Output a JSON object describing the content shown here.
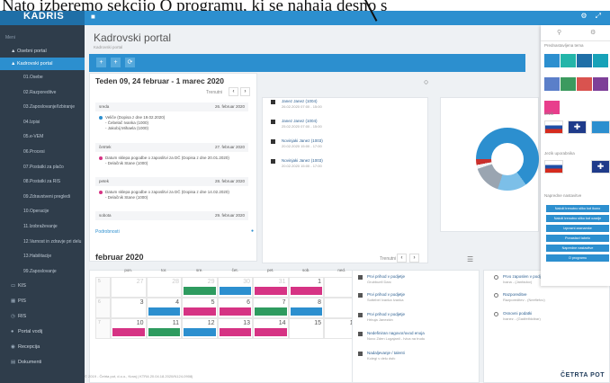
{
  "caption": "Nato izberemo sekcijo O programu, ki se nahaja desno s",
  "app": {
    "logo": "KADRIS",
    "page_title": "Kadrovski portal",
    "page_subtitle": "Kadrovski portal",
    "footer": "© 2019 - Četrta pot, d.o.o., Kranj | KTRA 20.04.18.2020/N124-0908|",
    "brand": "ČETRTA POT"
  },
  "sidebar": {
    "header": "Meni",
    "top_items": [
      "Osebni portal",
      "Kadrovski portal"
    ],
    "sub_items": [
      "01.Osebe",
      "02.Razporeditve",
      "03.Zaposlovanje/Izbiranje",
      "04.Izpisi",
      "05.e-VEM",
      "06.Procesi",
      "07.Postatki za plačo",
      "08.Postatki za RIS",
      "09.Zdravstveni pregledi",
      "10.Operacije",
      "11.Izobraževanje",
      "12.Varnost in zdravje pri delu",
      "13.Habilitacije",
      "99.Zaposlovanje"
    ],
    "bottom_items": [
      "KIS",
      "PIS",
      "RIS",
      "Portal vodij",
      "Recepcija",
      "Dokumenti"
    ]
  },
  "actions": [
    "+",
    "+",
    "⟳"
  ],
  "week": {
    "title": "Teden 09, 24 februar - 1 marec 2020",
    "today": "Trenutni",
    "days": [
      {
        "name": "sreda",
        "date": "26. februar 2020"
      },
      {
        "name": "četrtek",
        "date": "27. februar 2020"
      },
      {
        "name": "petek",
        "date": "28. februar 2020"
      },
      {
        "name": "sobota",
        "date": "29. februar 2020"
      }
    ],
    "events": [
      {
        "lines": [
          "Veliče (Dopisa z dne 19.02.2020)",
          "- Čebelač Ivanka (1000)",
          "- Jakobij Mihaela (1000)"
        ],
        "color": "#2c8fcf"
      },
      {
        "lines": [
          "Datum sklepa pogodbe o zaposlitvi za DČ (Dopisa z dne 20.01.2020)",
          "- Delačnik Stane (1000)"
        ],
        "color": "#d63384"
      },
      {
        "lines": [
          "Datum sklepa pogodbe o zaposlitvi za DČ (Dopisa z dne 14.02.2020)",
          "- Delačnik Stane (1000)"
        ],
        "color": "#d63384"
      }
    ],
    "footer_link": "Podrobnosti"
  },
  "notifications": [
    {
      "title": "Janez Janez (1004)",
      "sub": "26.02.2020 07:00 - 15:00"
    },
    {
      "title": "Janez Janez (1004)",
      "sub": "25.02.2020 07:00 - 15:00"
    },
    {
      "title": "Novinjaki Janez (1003)",
      "sub": "20.02.2020 15:00 - 17:00"
    },
    {
      "title": "Novinjaki Janez (1003)",
      "sub": "20.02.2020 15:00 - 17:00"
    }
  ],
  "panel": {
    "tabs": [
      "⚲",
      "⚙"
    ],
    "theme_label": "Prednastavljena tema",
    "theme_colors": [
      "#2c8fcf",
      "#23b5a9",
      "#1f6fa7",
      "#17a2b8",
      "#5b7fc9",
      "#3c9a5f",
      "#d9534f",
      "#7e3f98",
      "#e83e8c"
    ],
    "language_label": "Jezik",
    "language_flags": [
      "SI",
      "EN",
      "HR"
    ],
    "short_label": "Jezik uporabnika",
    "short_flags": [
      "SI",
      "EN"
    ],
    "settings_label": "Napredne nastavitve",
    "buttons": [
      "Naloži trenutno sliko kot ikono",
      "Naloži trenutno sliko kot ozadje",
      "Izprazni zaznamke",
      "Ponastavi tabelo",
      "Napredne nastavitve",
      "O programu"
    ]
  },
  "month": {
    "title": "februar 2020",
    "today": "Trenutni",
    "weekdays": [
      "pon.",
      "tor.",
      "sre.",
      "čet.",
      "pet.",
      "sob.",
      "ned."
    ],
    "rows": [
      {
        "week": "5",
        "days": [
          "27",
          "28",
          "29",
          "30",
          "31",
          "1",
          "2"
        ]
      },
      {
        "week": "6",
        "days": [
          "3",
          "4",
          "5",
          "6",
          "7",
          "8",
          "9"
        ]
      },
      {
        "week": "7",
        "days": [
          "10",
          "11",
          "12",
          "13",
          "14",
          "15",
          "16"
        ]
      }
    ]
  },
  "todo_list": [
    {
      "title": "Prvi prihod v podjetje",
      "sub": "Grubbuell Darc"
    },
    {
      "title": "Prvi prihod v podjetje",
      "sub": "Sottebel Ivanka Ivanka"
    },
    {
      "title": "Prvi prihod v podjetje",
      "sub": "Hrbuja Janezkin"
    },
    {
      "title": "Nedefiniran nagovor/uvod enoja",
      "sub": "Novo Zden Lugajanii - Ivica na trudu"
    },
    {
      "title": "Nadaljevanje / talenti",
      "sub": "Kolegi v delu dsfc"
    }
  ],
  "right_list": [
    {
      "title": "Prvo zaposlen v podj...",
      "sub": "Ivana - (Janfadov)"
    },
    {
      "title": "Razporeditve",
      "sub": "Razporeditev - (Neefiefov)"
    },
    {
      "title": "Osnovni podatki",
      "sub": "Ivanez - (Gadfelfdcibar)"
    }
  ]
}
